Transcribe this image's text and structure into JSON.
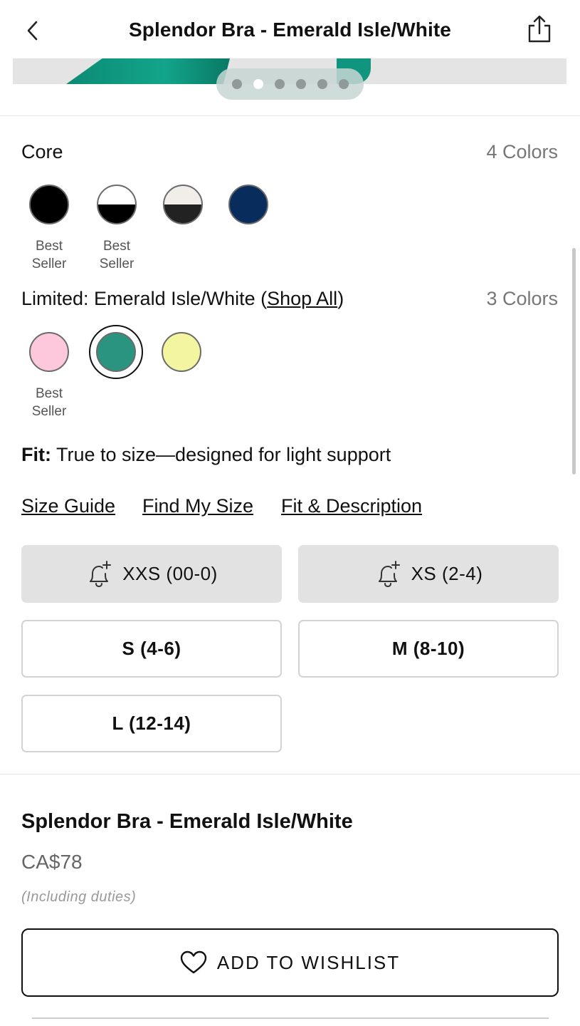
{
  "header": {
    "title": "Splendor Bra - Emerald Isle/White",
    "back_icon": "chevron-left-icon",
    "share_icon": "share-icon"
  },
  "gallery": {
    "image_count": 6,
    "active_index": 1
  },
  "core": {
    "label": "Core",
    "count": "4 Colors",
    "swatches": [
      {
        "color": "#000000",
        "style": "solid",
        "caption_line1": "Best",
        "caption_line2": "Seller"
      },
      {
        "color_top": "#ffffff",
        "color_bottom": "#000000",
        "style": "split",
        "caption_line1": "Best",
        "caption_line2": "Seller"
      },
      {
        "color_top": "#f1eeea",
        "color_bottom": "#222222",
        "style": "split"
      },
      {
        "color": "#082c5c",
        "style": "solid"
      }
    ]
  },
  "limited": {
    "label_prefix": "Limited: Emerald Isle/White (",
    "shop_all": "Shop All",
    "label_suffix": ")",
    "count": "3 Colors",
    "swatches": [
      {
        "color": "#fdc8dc",
        "caption_line1": "Best",
        "caption_line2": "Seller"
      },
      {
        "color": "#2a9480",
        "selected": true
      },
      {
        "color": "#f3f5a0"
      }
    ]
  },
  "fit": {
    "label": "Fit:",
    "text": " True to size—designed for light support"
  },
  "links": {
    "size_guide": "Size Guide",
    "find_my_size": "Find My Size",
    "fit_description": "Fit & Description"
  },
  "sizes": [
    {
      "label": "XXS (00-0)",
      "sold_out": true,
      "icon": "bell-plus-icon"
    },
    {
      "label": "XS (2-4)",
      "sold_out": true,
      "icon": "bell-plus-icon"
    },
    {
      "label": "S (4-6)",
      "sold_out": false
    },
    {
      "label": "M (8-10)",
      "sold_out": false
    },
    {
      "label": "L (12-14)",
      "sold_out": false
    }
  ],
  "product": {
    "name": "Splendor Bra - Emerald Isle/White",
    "price": "CA$78",
    "duties": "(Including duties)"
  },
  "wishlist": {
    "label": "ADD TO WISHLIST",
    "icon": "heart-icon"
  },
  "colors": {
    "text": "#111111",
    "muted": "#777777",
    "sold_out_bg": "#e2e2e2"
  }
}
